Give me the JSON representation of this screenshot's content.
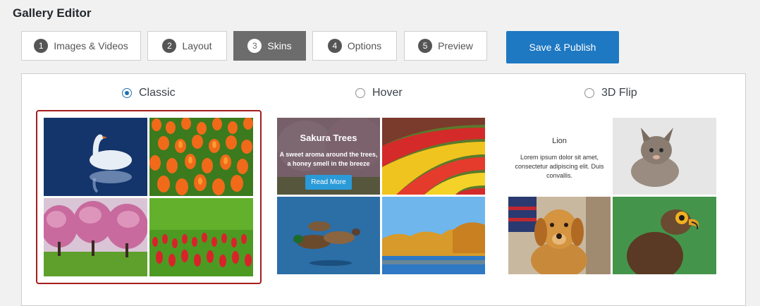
{
  "header": {
    "title": "Gallery Editor"
  },
  "steps": [
    {
      "num": "1",
      "label": "Images & Videos",
      "active": false
    },
    {
      "num": "2",
      "label": "Layout",
      "active": false
    },
    {
      "num": "3",
      "label": "Skins",
      "active": true
    },
    {
      "num": "4",
      "label": "Options",
      "active": false
    },
    {
      "num": "5",
      "label": "Preview",
      "active": false
    }
  ],
  "publish_label": "Save & Publish",
  "skins": {
    "selected": "Classic",
    "classic": {
      "label": "Classic"
    },
    "hover": {
      "label": "Hover",
      "card_title": "Sakura Trees",
      "card_desc": "A sweet aroma around the trees, a honey smell in the breeze",
      "card_button": "Read More"
    },
    "flip": {
      "label": "3D Flip",
      "card_title": "Lion",
      "card_desc": "Lorem ipsum dolor sit amet, consectetur adipiscing elit. Duis convallis."
    }
  },
  "colors": {
    "accent": "#1e78c2",
    "selected_border": "#a51d1d",
    "active_tab": "#6c6c6c"
  },
  "images": [
    "swan-photo",
    "tulips-orange-photo",
    "cherry-trees-photo",
    "red-tulips-photo",
    "tulip-rows-photo",
    "ducks-photo",
    "river-autumn-photo",
    "kitten-photo",
    "golden-retriever-photo",
    "eagle-photo"
  ]
}
